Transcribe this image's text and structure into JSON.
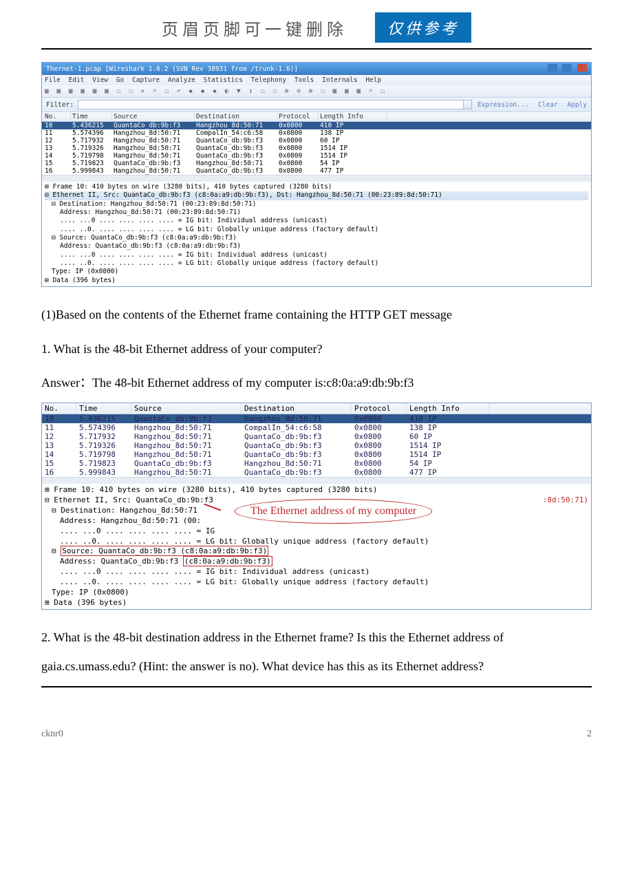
{
  "header": {
    "title": "页眉页脚可一键删除",
    "badge": "仅供参考"
  },
  "ws1": {
    "title": "Thernet-1.pcap  [Wireshark 1.6.2  (SVN Rev 38931 from /trunk-1.6)]",
    "menus": [
      "File",
      "Edit",
      "View",
      "Go",
      "Capture",
      "Analyze",
      "Statistics",
      "Telephony",
      "Tools",
      "Internals",
      "Help"
    ],
    "toolbar_glyphs": "▦ ▦ ▦ ▦ ▦ ▦   ☐ ☐ ✕ ☼ ☐   ↶ ◆ ◆ ◆ ◐ ▼ ↧   ☐ ☐   ⊕ ⊖ ⊕ ☐   ▦ ▦ ▦ ☼   ☐",
    "filter": {
      "label": "Filter:",
      "links": [
        "Expression...",
        "Clear",
        "Apply"
      ]
    },
    "columns": [
      "No.",
      "Time",
      "Source",
      "Destination",
      "Protocol",
      "Length Info"
    ],
    "rows": [
      {
        "no": "10",
        "time": "5.436215",
        "src": "QuantaCo_db:9b:f3",
        "dst": "Hangzhou_8d:50:71",
        "proto": "0x0800",
        "len": "410 IP",
        "sel": true
      },
      {
        "no": "11",
        "time": "5.574396",
        "src": "Hangzhou_8d:50:71",
        "dst": "CompalIn_54:c6:58",
        "proto": "0x0800",
        "len": "138 IP"
      },
      {
        "no": "12",
        "time": "5.717932",
        "src": "Hangzhou_8d:50:71",
        "dst": "QuantaCo_db:9b:f3",
        "proto": "0x0800",
        "len": "60 IP"
      },
      {
        "no": "13",
        "time": "5.719326",
        "src": "Hangzhou_8d:50:71",
        "dst": "QuantaCo_db:9b:f3",
        "proto": "0x0800",
        "len": "1514 IP"
      },
      {
        "no": "14",
        "time": "5.719798",
        "src": "Hangzhou_8d:50:71",
        "dst": "QuantaCo_db:9b:f3",
        "proto": "0x0800",
        "len": "1514 IP"
      },
      {
        "no": "15",
        "time": "5.719823",
        "src": "QuantaCo_db:9b:f3",
        "dst": "Hangzhou_8d:50:71",
        "proto": "0x0800",
        "len": "54 IP"
      },
      {
        "no": "16",
        "time": "5.999843",
        "src": "Hangzhou_8d:50:71",
        "dst": "QuantaCo_db:9b:f3",
        "proto": "0x0800",
        "len": "477 IP"
      }
    ],
    "tree": [
      {
        "t": "⊞ Frame 10: 410 bytes on wire (3280 bits), 410 bytes captured (3280 bits)",
        "i": 0
      },
      {
        "t": "⊟ Ethernet II, Src: QuantaCo_db:9b:f3 (c8:0a:a9:db:9b:f3), Dst: Hangzhou_8d:50:71 (00:23:89:8d:50:71)",
        "i": 0,
        "sel": true
      },
      {
        "t": "⊟ Destination: Hangzhou_8d:50:71 (00:23:89:8d:50:71)",
        "i": 1
      },
      {
        "t": "Address: Hangzhou_8d:50:71 (00:23:89:8d:50:71)",
        "i": 2
      },
      {
        "t": ".... ...0 .... .... .... .... = IG bit: Individual address (unicast)",
        "i": 2
      },
      {
        "t": ".... ..0. .... .... .... .... = LG bit: Globally unique address (factory default)",
        "i": 2
      },
      {
        "t": "⊟ Source: QuantaCo_db:9b:f3 (c8:0a:a9:db:9b:f3)",
        "i": 1
      },
      {
        "t": "Address: QuantaCo_db:9b:f3 (c8:0a:a9:db:9b:f3)",
        "i": 2
      },
      {
        "t": ".... ...0 .... .... .... .... = IG bit: Individual address (unicast)",
        "i": 2
      },
      {
        "t": ".... ..0. .... .... .... .... = LG bit: Globally unique address (factory default)",
        "i": 2
      },
      {
        "t": "Type: IP (0x0800)",
        "i": 1
      },
      {
        "t": "⊞ Data (396 bytes)",
        "i": 0
      }
    ]
  },
  "qa": {
    "intro": "(1)Based on the contents of the Ethernet frame containing the HTTP GET message",
    "q1": "1. What is the 48-bit Ethernet address of your computer?",
    "a1_label": "Answer：",
    "a1_text": "The 48-bit Ethernet address of my computer is:c8:0a:a9:db:9b:f3",
    "q2": "2. What is the 48-bit destination address in the Ethernet frame? Is this the Ethernet address of gaia.cs.umass.edu? (Hint: the answer is no). What device has this as its Ethernet address?"
  },
  "ws2": {
    "columns": [
      "No.",
      "Time",
      "Source",
      "Destination",
      "Protocol",
      "Length Info"
    ],
    "rows": [
      {
        "no": "10",
        "time": "5.436215",
        "src": "QuantaCo_db:9b:f3",
        "dst": "Hangzhou_8d:50:71",
        "proto": "0x0800",
        "len": "410 IP",
        "sel": true
      },
      {
        "no": "11",
        "time": "5.574396",
        "src": "Hangzhou_8d:50:71",
        "dst": "CompalIn_54:c6:58",
        "proto": "0x0800",
        "len": "138 IP"
      },
      {
        "no": "12",
        "time": "5.717932",
        "src": "Hangzhou_8d:50:71",
        "dst": "QuantaCo_db:9b:f3",
        "proto": "0x0800",
        "len": "60 IP"
      },
      {
        "no": "13",
        "time": "5.719326",
        "src": "Hangzhou_8d:50:71",
        "dst": "QuantaCo_db:9b:f3",
        "proto": "0x0800",
        "len": "1514 IP"
      },
      {
        "no": "14",
        "time": "5.719798",
        "src": "Hangzhou_8d:50:71",
        "dst": "QuantaCo_db:9b:f3",
        "proto": "0x0800",
        "len": "1514 IP"
      },
      {
        "no": "15",
        "time": "5.719823",
        "src": "QuantaCo_db:9b:f3",
        "dst": "Hangzhou_8d:50:71",
        "proto": "0x0800",
        "len": "54 IP"
      },
      {
        "no": "16",
        "time": "5.999843",
        "src": "Hangzhou_8d:50:71",
        "dst": "QuantaCo_db:9b:f3",
        "proto": "0x0800",
        "len": "477 IP"
      }
    ],
    "tree": {
      "l0": "⊞ Frame 10: 410 bytes on wire (3280 bits), 410 bytes captured (3280 bits)",
      "l1a": "⊟ Ethernet II, Src: QuantaCo_db:9b:f3",
      "l1b": ":8d:50:71)",
      "l2": "⊟ Destination: Hangzhou_8d:50:71",
      "l3": "Address: Hangzhou_8d:50:71 (00:",
      "l4": ".... ...0 .... .... .... .... = IG",
      "l5": ".... ..0. .... .... .... .... = LG bit: Globally unique address (factory default)",
      "l6a": "⊟ ",
      "l6b": "Source: QuantaCo_db:9b:f3 (c8:0a:a9:db:9b:f3)",
      "l7a": "Address: QuantaCo_db:9b:f3 ",
      "l7b": "(c8:0a:a9:db:9b:f3)",
      "l8": ".... ...0 .... .... .... .... = IG bit: Individual address (unicast)",
      "l9": ".... ..0. .... .... .... .... = LG bit: Globally unique address (factory default)",
      "l10": "Type: IP (0x0800)",
      "l11": "⊞ Data (396 bytes)"
    },
    "callout": "The Ethernet address of my computer"
  },
  "footer": {
    "left": "cknr0",
    "right": "2"
  }
}
